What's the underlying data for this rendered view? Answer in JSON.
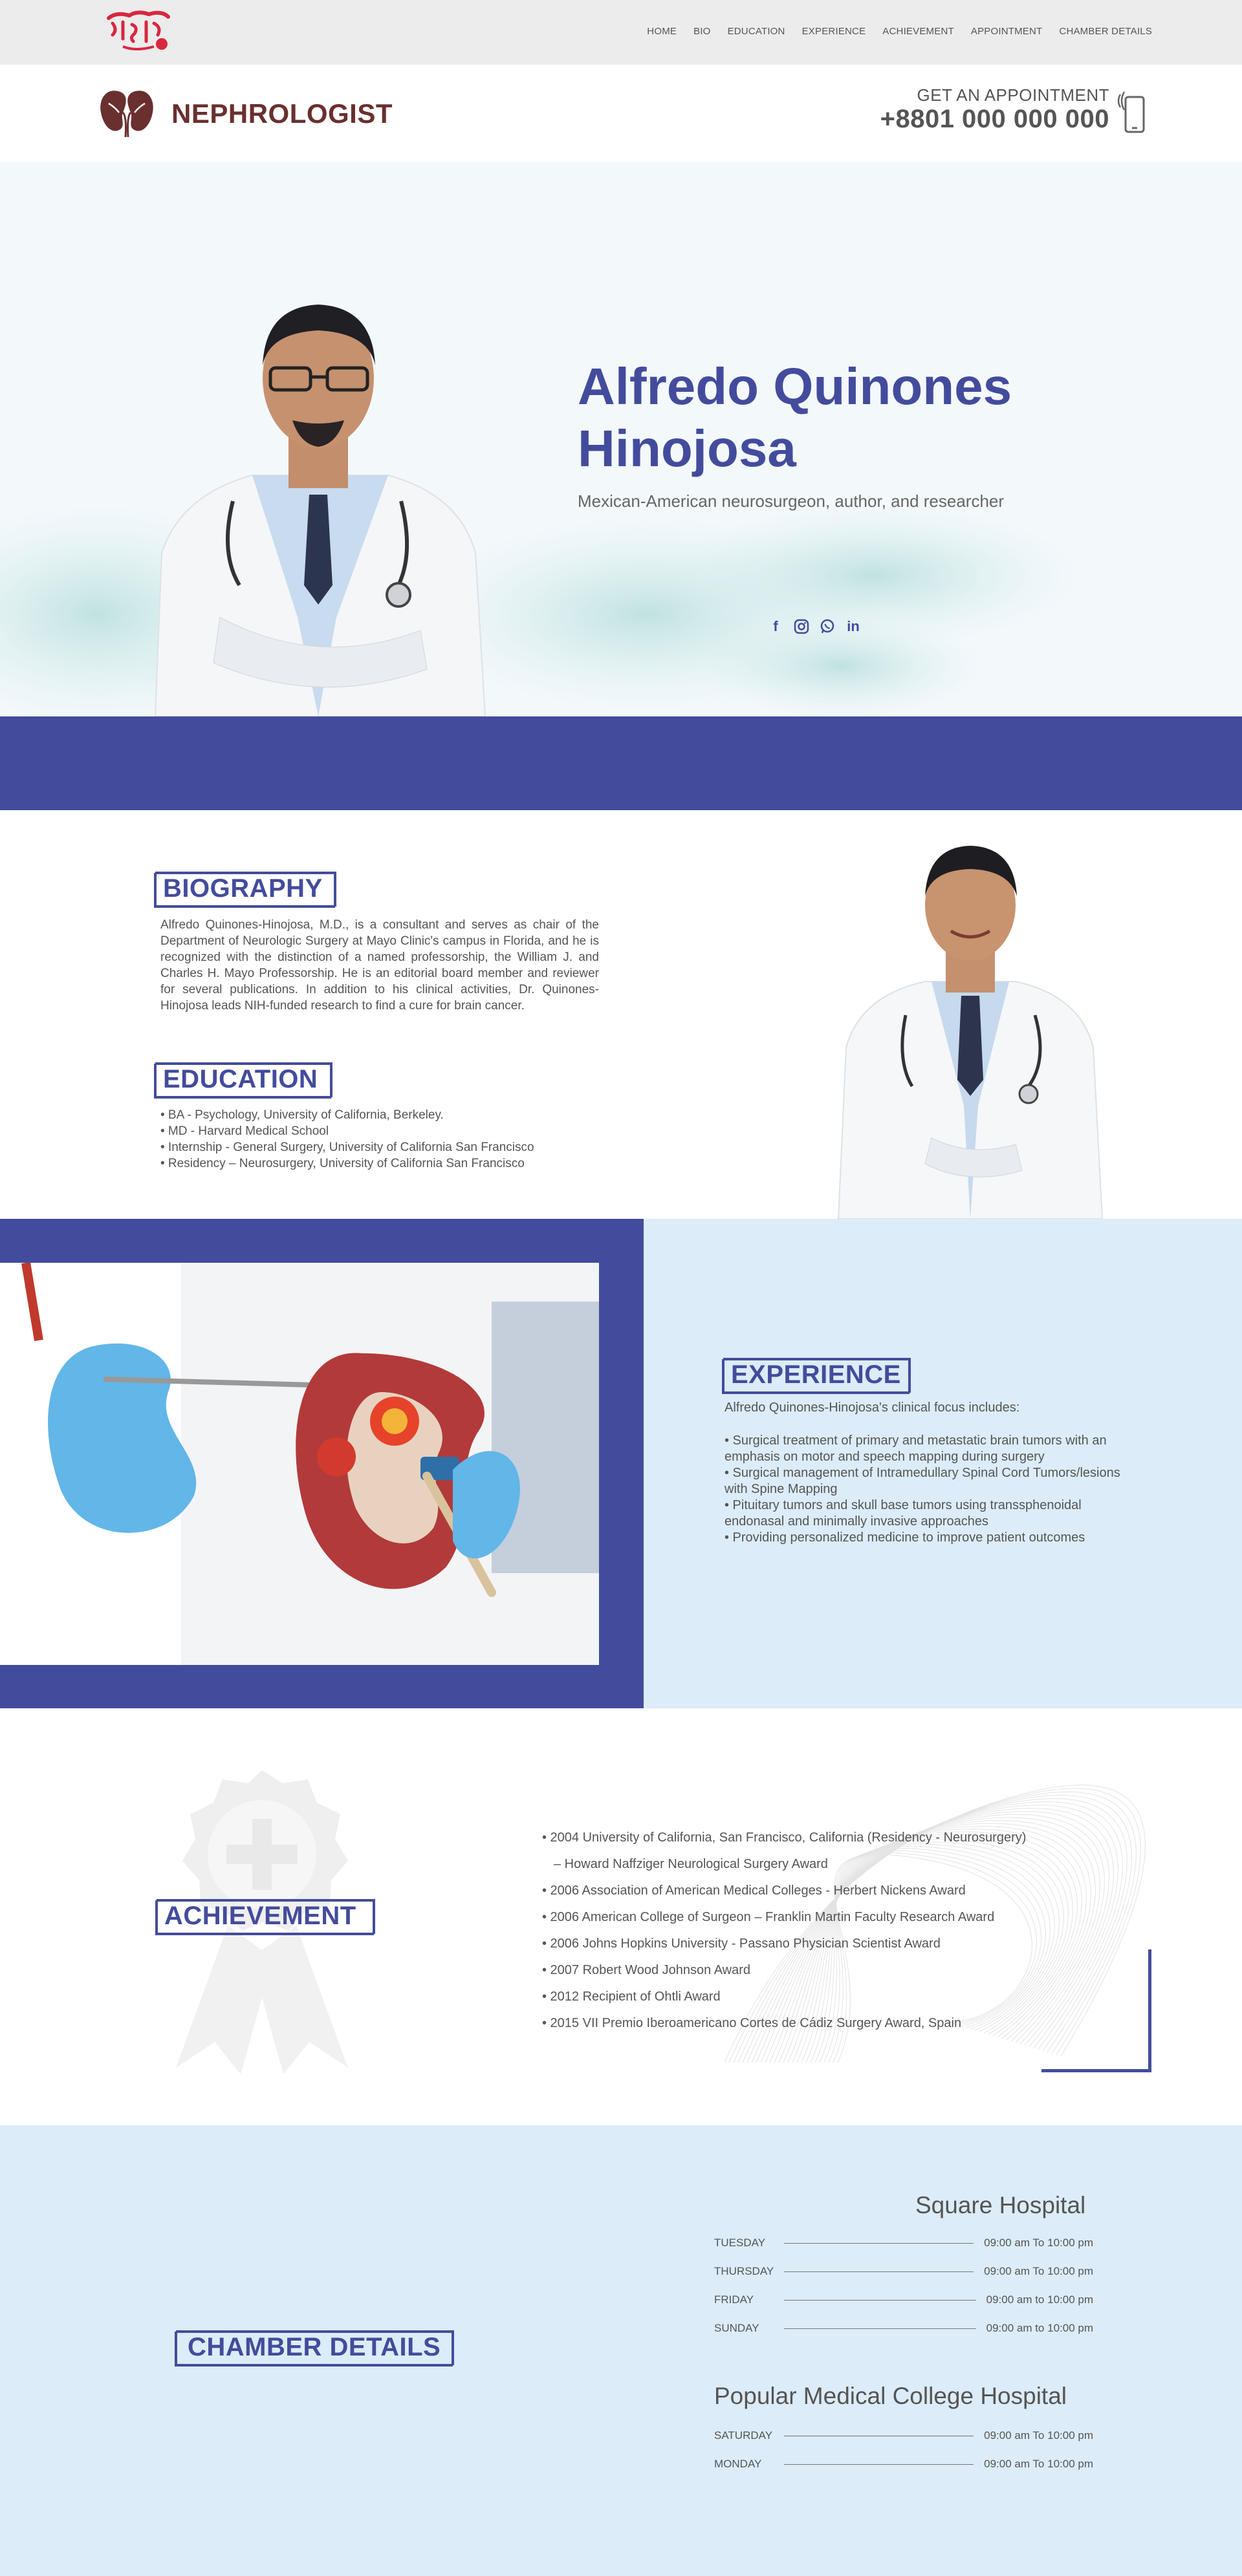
{
  "logo": {
    "text": "ডাক্তার বন্ধু",
    "color": "#d9273e"
  },
  "nav": [
    "HOME",
    "BIO",
    "EDUCATION",
    "EXPERIENCE",
    "ACHIEVEMENT",
    "APPOINTMENT",
    "CHAMBER DETAILS"
  ],
  "header": {
    "brand": "NEPHROLOGIST",
    "appointment_label": "GET AN APPOINTMENT",
    "phone": "+8801 000 000 000"
  },
  "hero": {
    "name": "Alfredo Quinones Hinojosa",
    "subtitle": "Mexican-American neurosurgeon, author, and researcher",
    "socials": [
      "facebook-icon",
      "instagram-icon",
      "whatsapp-icon",
      "linkedin-icon"
    ]
  },
  "biography": {
    "title": "BIOGRAPHY",
    "text": "Alfredo Quinones-Hinojosa, M.D., is a consultant and serves as chair of the Department of Neurologic Surgery at Mayo Clinic's campus in Florida, and he is recognized with the distinction of a named professorship, the William J. and Charles H. Mayo Professorship. He is an editorial board member and reviewer for several publications. In addition to his clinical activities, Dr. Quinones-Hinojosa leads NIH-funded research to find a cure for brain cancer."
  },
  "education": {
    "title": "EDUCATION",
    "items": [
      "• BA - Psychology, University of California, Berkeley.",
      "• MD - Harvard Medical School",
      "• Internship - General Surgery, University of California San Francisco",
      "• Residency – Neurosurgery, University of California San Francisco"
    ]
  },
  "experience": {
    "title": "EXPERIENCE",
    "intro": "Alfredo Quinones-Hinojosa's clinical focus includes:",
    "items": [
      "• Surgical treatment of primary and metastatic brain tumors with an emphasis on motor and speech mapping during surgery",
      "• Surgical management of Intramedullary Spinal Cord Tumors/lesions with Spine Mapping",
      "• Pituitary tumors and skull base tumors using transsphenoidal endonasal and minimally invasive approaches",
      "• Providing personalized medicine to improve patient outcomes"
    ]
  },
  "achievement": {
    "title": "ACHIEVEMENT",
    "items": [
      "• 2004 University of California, San Francisco, California (Residency - Neurosurgery)",
      "   – Howard Naffziger Neurological Surgery Award",
      "• 2006 Association of American Medical Colleges - Herbert Nickens Award",
      "• 2006 American College of Surgeon – Franklin Martin Faculty Research Award",
      "• 2006 Johns Hopkins University - Passano Physician Scientist Award",
      "• 2007 Robert Wood Johnson Award",
      "• 2012 Recipient of Ohtli Award",
      "• 2015 VII Premio Iberoamericano Cortes de Cádiz Surgery Award, Spain"
    ]
  },
  "chamber": {
    "title": "CHAMBER DETAILS",
    "hospitals": [
      {
        "name": "Square Hospital",
        "schedule": [
          {
            "day": "TUESDAY",
            "time": "09:00 am To 10:00 pm"
          },
          {
            "day": "THURSDAY",
            "time": "09:00 am To 10:00 pm"
          },
          {
            "day": "FRIDAY",
            "time": "09:00 am to 10:00 pm"
          },
          {
            "day": "SUNDAY",
            "time": "09:00 am to 10:00 pm"
          }
        ]
      },
      {
        "name": "Popular Medical College Hospital",
        "schedule": [
          {
            "day": "SATURDAY",
            "time": "09:00 am To 10:00 pm"
          },
          {
            "day": "MONDAY",
            "time": "09:00 am To 10:00 pm"
          }
        ]
      }
    ]
  },
  "colors": {
    "accent": "#434c9c",
    "brand": "#6a2f2f",
    "light_bg": "#dcecf8",
    "logo": "#d9273e"
  }
}
